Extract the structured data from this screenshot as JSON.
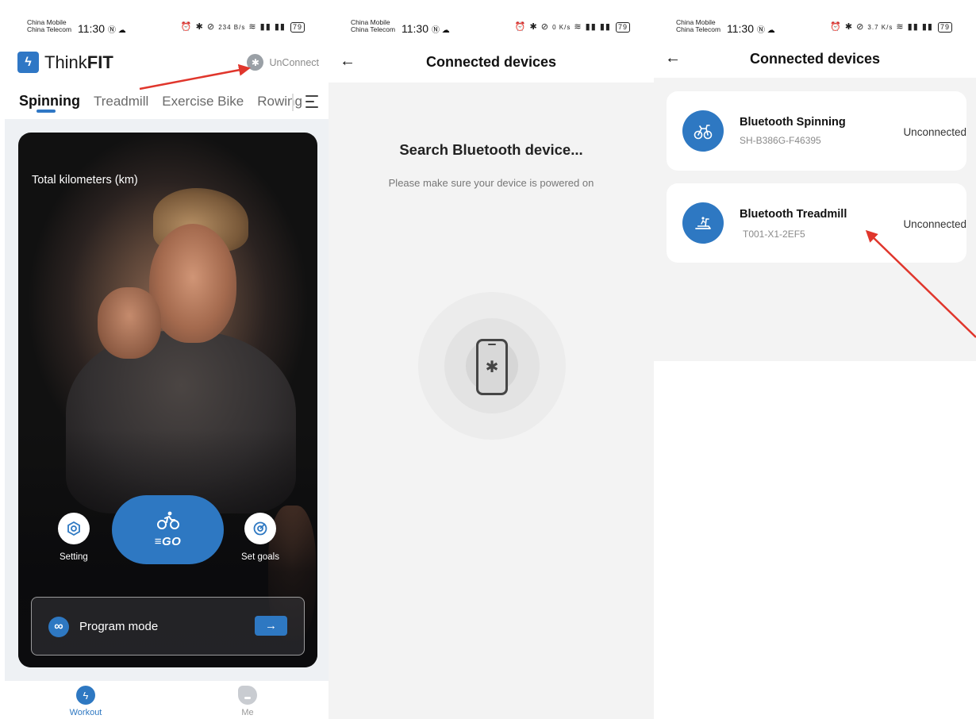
{
  "status_bar": {
    "carrier_1": "China Mobile",
    "carrier_2": "China Telecom",
    "time": "11:30",
    "battery": "79",
    "net_speed_1": "234 B/s",
    "net_speed_2": "0 K/s",
    "net_speed_3": "3.7 K/s"
  },
  "home": {
    "brand_light": "Think",
    "brand_bold": "FIT",
    "unconnect_label": "UnConnect",
    "tabs": [
      "Spinning",
      "Treadmill",
      "Exercise Bike",
      "Rowing"
    ],
    "hero_label": "Total kilometers (km)",
    "setting_label": "Setting",
    "go_label": "GO",
    "goals_label": "Set goals",
    "program_label": "Program mode",
    "program_arrow": "→",
    "nav": [
      {
        "label": "Workout",
        "icon": "lightning-icon",
        "color": "#2e78c2"
      },
      {
        "label": "Me",
        "icon": "profile-icon",
        "color": "#c9ccd1"
      }
    ]
  },
  "search": {
    "back": "←",
    "title": "Connected devices",
    "heading": "Search Bluetooth device...",
    "subtext": "Please make sure your device is powered on"
  },
  "devices": {
    "back": "←",
    "title": "Connected devices",
    "items": [
      {
        "name": "Bluetooth Spinning",
        "id": "SH-B386G-F46395",
        "status": "Unconnected",
        "icon": "bike-icon"
      },
      {
        "name": "Bluetooth Treadmill",
        "id": "T001-X1-2EF5",
        "status": "Unconnected",
        "icon": "treadmill-icon"
      }
    ]
  },
  "colors": {
    "accent": "#2e78c2",
    "annotation": "#e0362c"
  }
}
